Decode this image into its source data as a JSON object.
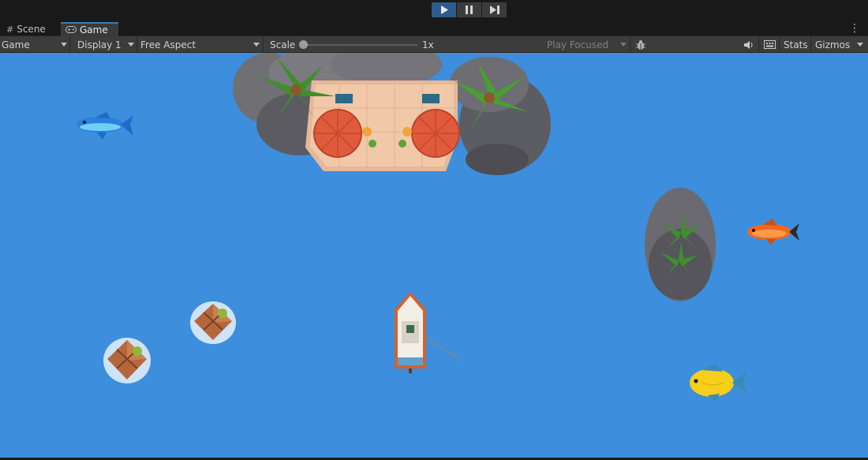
{
  "playbar": {
    "play_icon": "play-icon",
    "pause_icon": "pause-icon",
    "step_icon": "step-icon"
  },
  "tabs": [
    {
      "label": "Scene",
      "icon": "grid-icon"
    },
    {
      "label": "Game",
      "icon": "gamepad-icon"
    }
  ],
  "toolbar": {
    "view_select": "Game",
    "display_select": "Display 1",
    "aspect_select": "Free Aspect",
    "scale_label": "Scale",
    "scale_value": "1x",
    "play_focused": "Play Focused",
    "stats": "Stats",
    "gizmos": "Gizmos"
  },
  "colors": {
    "ocean": "#3d8edc",
    "editor_bg": "#191919",
    "toolbar_bg": "#3c3c3c",
    "accent": "#2d5b8c"
  }
}
